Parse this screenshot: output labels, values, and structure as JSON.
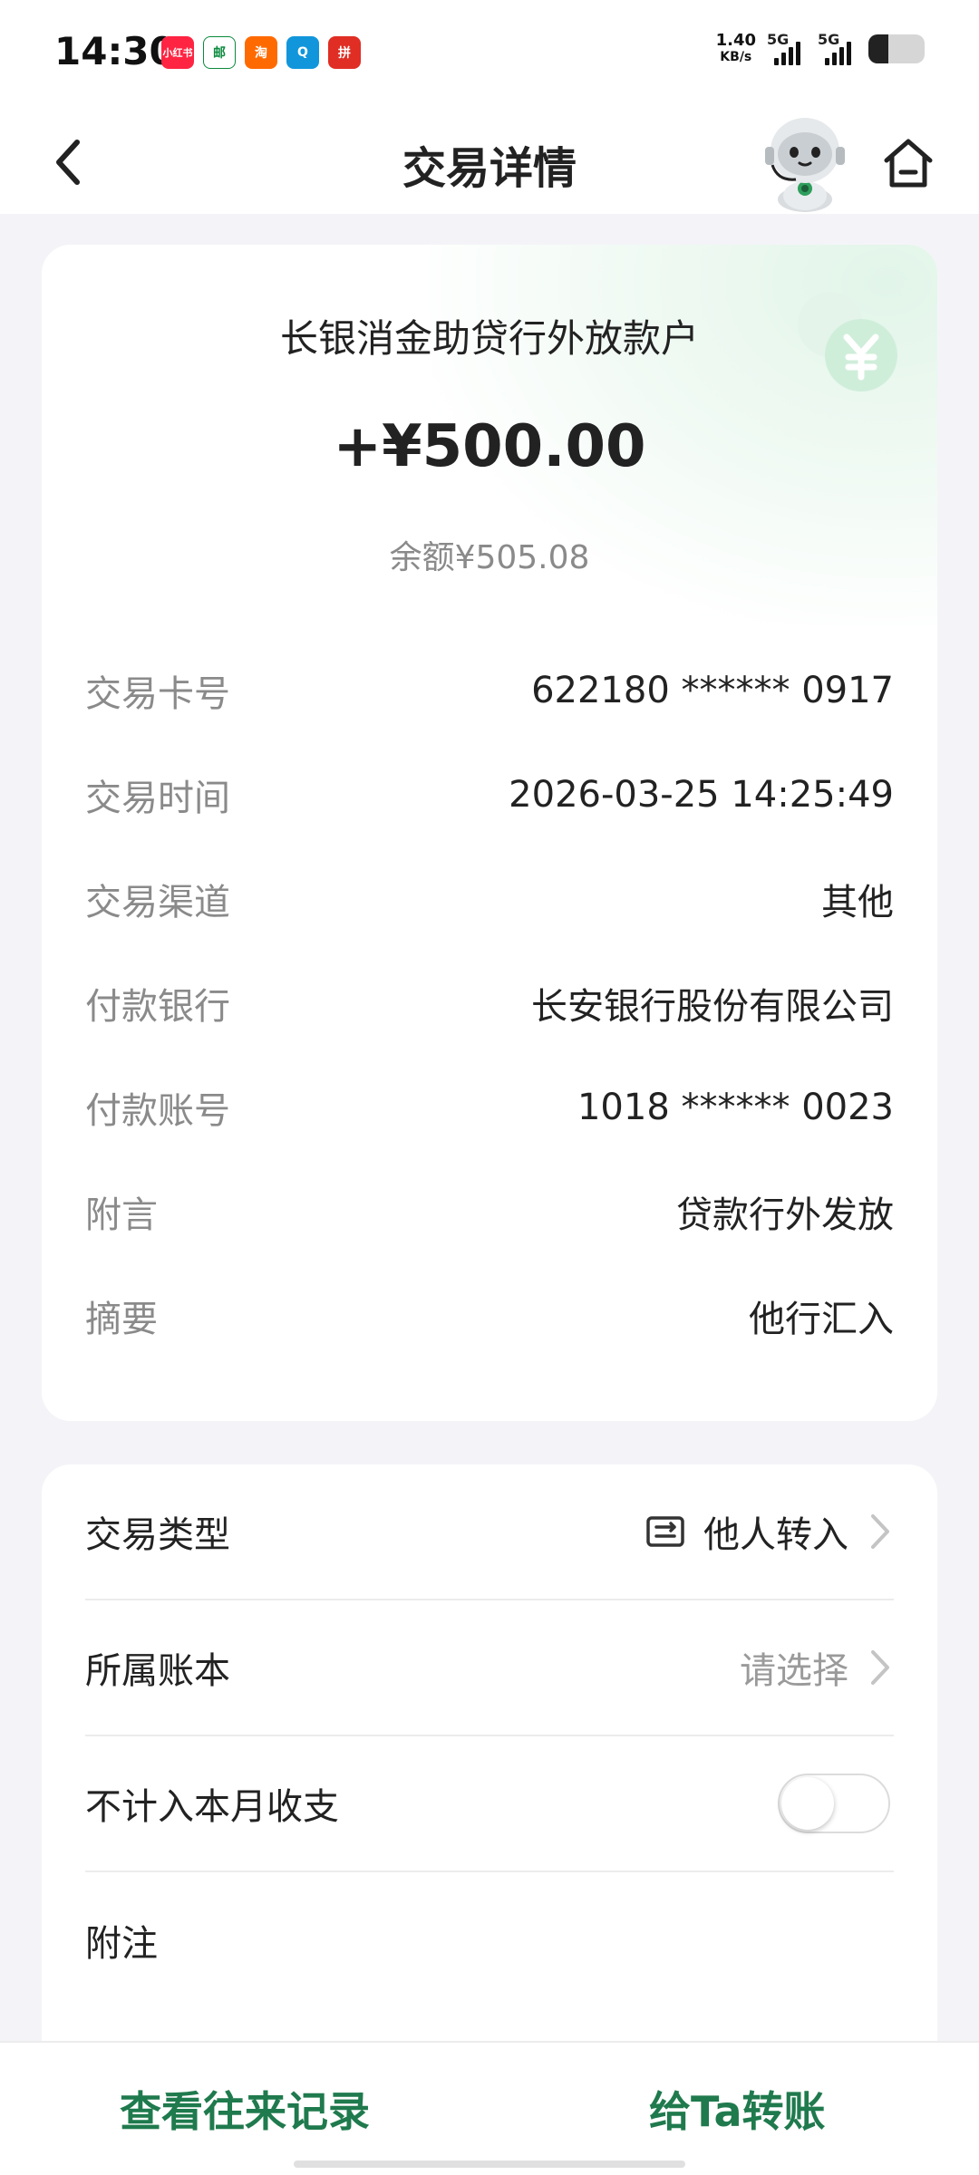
{
  "status_bar": {
    "time": "14:30",
    "apps": [
      {
        "name": "xiaohongshu-icon",
        "label": "小红书",
        "color": "#ff2442"
      },
      {
        "name": "china-post-icon",
        "label": "邮",
        "color": "#0b8a3e"
      },
      {
        "name": "taobao-icon",
        "label": "淘",
        "color": "#ff6a00"
      },
      {
        "name": "qq-icon",
        "label": "Q",
        "color": "#1296db"
      },
      {
        "name": "pinduoduo-icon",
        "label": "拼",
        "color": "#e02e24"
      }
    ],
    "net_speed_value": "1.40",
    "net_speed_unit": "KB/s",
    "signal1_label": "5G",
    "signal2_label": "5G",
    "battery_level": 0.35
  },
  "nav": {
    "title": "交易详情"
  },
  "transaction": {
    "title": "长银消金助贷行外放款户",
    "amount": "+¥500.00",
    "balance": "余额¥505.08",
    "details": [
      {
        "label": "交易卡号",
        "value": "622180 ****** 0917"
      },
      {
        "label": "交易时间",
        "value": "2026-03-25 14:25:49"
      },
      {
        "label": "交易渠道",
        "value": "其他"
      },
      {
        "label": "付款银行",
        "value": "长安银行股份有限公司"
      },
      {
        "label": "付款账号",
        "value": "1018 ****** 0023"
      },
      {
        "label": "附言",
        "value": "贷款行外发放"
      },
      {
        "label": "摘要",
        "value": "他行汇入"
      }
    ]
  },
  "options": {
    "type_label": "交易类型",
    "type_value": "他人转入",
    "ledger_label": "所属账本",
    "ledger_placeholder": "请选择",
    "exclude_label": "不计入本月收支",
    "exclude_on": false,
    "note_label": "附注"
  },
  "bottom": {
    "history_label": "查看往来记录",
    "transfer_label": "给Ta转账"
  },
  "colors": {
    "accent": "#1f7a4d",
    "accent_light": "#cfeeda",
    "background": "#f4f4f8"
  }
}
